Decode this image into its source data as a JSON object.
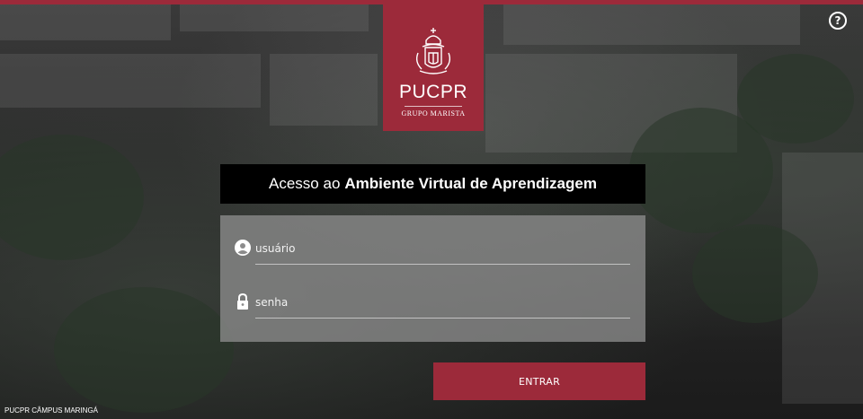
{
  "brand": {
    "name": "PUCPR",
    "subtitle": "GRUPO MARISTA",
    "color": "#9c2a3a"
  },
  "help": {
    "label": "?",
    "icon": "question-circle-icon"
  },
  "title": {
    "prefix": "Acesso ao",
    "emphasis": "Ambiente Virtual de Aprendizagem"
  },
  "form": {
    "username": {
      "placeholder": "usuário",
      "value": "",
      "icon": "user-circle-icon"
    },
    "password": {
      "placeholder": "senha",
      "value": "",
      "icon": "lock-icon"
    },
    "submit_label": "ENTRAR"
  },
  "footer": {
    "campus": "PUCPR CÂMPUS MARINGÁ"
  }
}
